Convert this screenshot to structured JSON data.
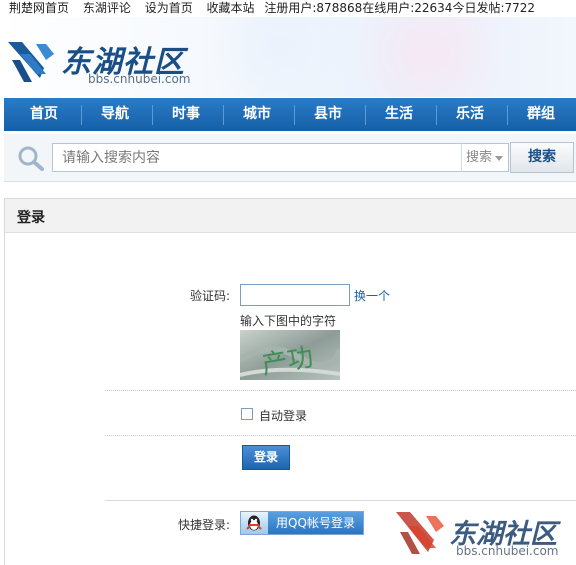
{
  "topbar": {
    "links": [
      "荆楚网首页",
      "东湖评论",
      "设为首页",
      "收藏本站"
    ],
    "stats": "注册用户:878868在线用户:22634今日发帖:7722"
  },
  "header": {
    "logo_text": "东湖社区",
    "logo_url": "bbs.cnhubei.com"
  },
  "nav": {
    "items": [
      "首页",
      "导航",
      "时事",
      "城市",
      "县市",
      "生活",
      "乐活",
      "群组"
    ]
  },
  "search": {
    "placeholder": "请输入搜索内容",
    "scope": "搜索",
    "button": "搜索"
  },
  "login": {
    "title": "登录",
    "captcha_label": "验证码:",
    "change_captcha": "换一个",
    "captcha_hint": "输入下图中的字符",
    "captcha_text": "产功",
    "auto_login": "自动登录",
    "submit": "登录",
    "quick_login_label": "快捷登录:",
    "qq_login": "用QQ帐号登录"
  },
  "watermark": {
    "text": "东湖社区",
    "url": "bbs.cnhubei.com"
  },
  "colors": {
    "brand_blue": "#1a4e86",
    "nav_blue": "#1d6bb5",
    "link_blue": "#1b5fa8",
    "accent_red": "#d9432c"
  }
}
